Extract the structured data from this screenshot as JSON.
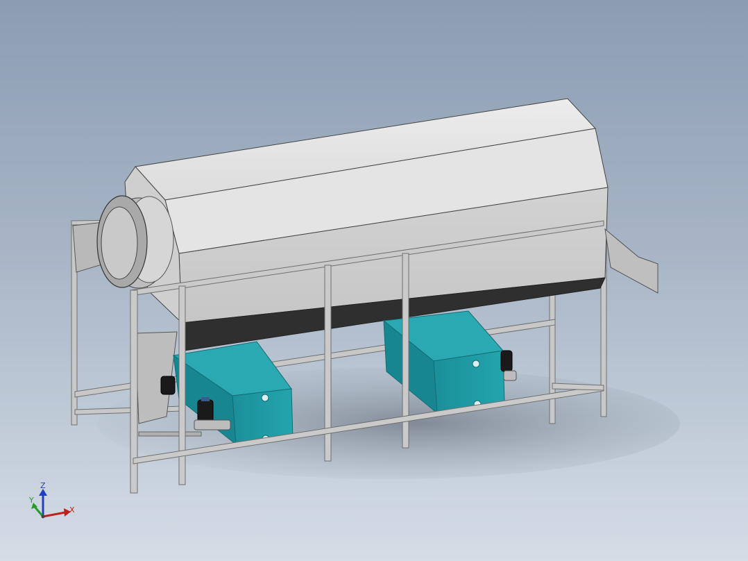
{
  "viewport": {
    "background_top": "#8c9db2",
    "background_bottom": "#d5dde6"
  },
  "model": {
    "drum_color": "#d9d9d9",
    "drum_light": "#e6e6e6",
    "drum_shadow": "#2e2e2e",
    "frame_color": "#c4c4c4",
    "tank_color": "#1e9ba6",
    "tank_top": "#2aa9b3",
    "pump_color": "#1a1a1a"
  },
  "triad": {
    "z_label": "Z",
    "y_label": "Y",
    "x_label": "X",
    "icon": "coordinate-triad-icon"
  }
}
